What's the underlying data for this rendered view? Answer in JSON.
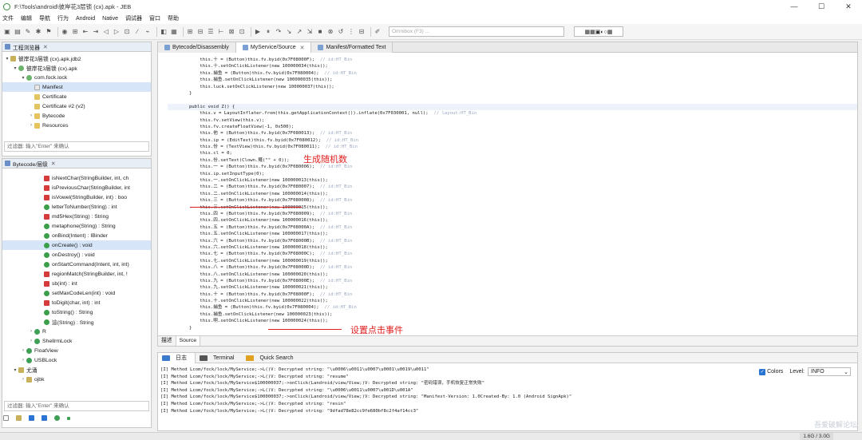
{
  "window": {
    "title": "F:\\Tools\\android\\彼岸花3层锁 (cx).apk - JEB",
    "controls": [
      "—",
      "☐",
      "✕"
    ]
  },
  "menu": [
    "文件",
    "编辑",
    "导航",
    "行为",
    "Android",
    "Native",
    "调试器",
    "窗口",
    "帮助"
  ],
  "toolbar": {
    "omnibox_placeholder": "Omnibox (F3) ...",
    "right_group": "▦▦▣◐○▦"
  },
  "project_panel": {
    "tab_label": "工程浏览器",
    "tree": [
      {
        "label": "彼岸花3层锁 (cx).apk.jdb2",
        "depth": 0,
        "icon": "package-icon",
        "arrow": "▾"
      },
      {
        "label": "彼岸花3层锁 (cx).apk",
        "depth": 1,
        "icon": "apk-icon",
        "arrow": "▾"
      },
      {
        "label": "com.fock.lock",
        "depth": 2,
        "icon": "apk-icon",
        "arrow": "▾"
      },
      {
        "label": "Manifest",
        "depth": 3,
        "icon": "file-icon",
        "arrow": "",
        "selected": true
      },
      {
        "label": "Certificate",
        "depth": 3,
        "icon": "cert-icon",
        "arrow": ""
      },
      {
        "label": "Certificate #2 (v2)",
        "depth": 3,
        "icon": "cert-icon",
        "arrow": ""
      },
      {
        "label": "Bytecode",
        "depth": 3,
        "icon": "folder-icon",
        "arrow": "›"
      },
      {
        "label": "Resources",
        "depth": 3,
        "icon": "folder-icon",
        "arrow": "›"
      }
    ],
    "filter_placeholder": "过滤器: 输入\"Enter\" 来确认"
  },
  "hierarchy_panel": {
    "tab_label": "Bytecode/层级",
    "tree": [
      {
        "label": "isNextChar(StringBuilder, int, ch",
        "icon": "red",
        "depth": 4
      },
      {
        "label": "isPreviousChar(StringBuilder, int",
        "icon": "red",
        "depth": 4
      },
      {
        "label": "isVowel(StringBuilder, int) : boo",
        "icon": "red",
        "depth": 4
      },
      {
        "label": "letterToNumber(String) : int",
        "icon": "green",
        "depth": 4
      },
      {
        "label": "md5Hex(String) : String",
        "icon": "red",
        "depth": 4
      },
      {
        "label": "metaphone(String) : String",
        "icon": "green",
        "depth": 4
      },
      {
        "label": "onBind(Intent) : IBinder",
        "icon": "green",
        "depth": 4
      },
      {
        "label": "onCreate() : void",
        "icon": "green",
        "depth": 4,
        "selected": true
      },
      {
        "label": "onDestroy() : void",
        "icon": "green",
        "depth": 4
      },
      {
        "label": "onStartCommand(Intent, int, int)",
        "icon": "green",
        "depth": 4
      },
      {
        "label": "regionMatch(StringBuilder, int, !",
        "icon": "red",
        "depth": 4
      },
      {
        "label": "sb(int) : int",
        "icon": "red",
        "depth": 4
      },
      {
        "label": "setMaxCodeLen(int) : void",
        "icon": "green",
        "depth": 4
      },
      {
        "label": "toDigit(char, int) : int",
        "icon": "red",
        "depth": 4
      },
      {
        "label": "toString() : String",
        "icon": "green",
        "depth": 4
      },
      {
        "label": "這(String) : String",
        "icon": "green",
        "depth": 4
      },
      {
        "label": "R",
        "icon": "class",
        "depth": 2,
        "arrow": "›"
      },
      {
        "label": "ShellrmLock",
        "icon": "class",
        "depth": 2,
        "arrow": "›"
      },
      {
        "label": "FloatView",
        "icon": "class",
        "depth": 1,
        "arrow": "›"
      },
      {
        "label": "USBLock",
        "icon": "class",
        "depth": 1,
        "arrow": "›"
      },
      {
        "label": "尤涌",
        "icon": "pkg",
        "depth": 0,
        "arrow": "▾"
      },
      {
        "label": "ojbk",
        "icon": "pkg",
        "depth": 1,
        "arrow": "›"
      }
    ],
    "filter_placeholder": "过滤器: 输入\"Enter\" 来确认"
  },
  "editor": {
    "tabs": [
      {
        "label": "Bytecode/Disassembly",
        "active": false
      },
      {
        "label": "MyService/Source",
        "active": true,
        "close": "✕"
      },
      {
        "label": "Manifest/Formatted Text",
        "active": false
      }
    ],
    "code_lines": [
      {
        "t": "            this.十 = (Button)this.fv.byid(0x7F08000F);  // id:HT_Bin"
      },
      {
        "t": "            this.十.setOnClickListener(new 100000034(this));"
      },
      {
        "t": "            this.捕鱼 = (Button)this.fv.byid(0x7F080004);  // id:HT_Bin"
      },
      {
        "t": "            this.捕鱼.setOnClickListener(new 100000035(this));"
      },
      {
        "t": "            this.luck.setOnClickListener(new 100000037(this));"
      },
      {
        "t": "        }"
      },
      {
        "t": ""
      },
      {
        "t": "        public void Z() {",
        "hl": true
      },
      {
        "t": "            this.v = LayoutInflater.from(this.getApplicationContext()).inflate(0x7F030001, null);  // layout:HT_Bin"
      },
      {
        "t": "            this.fv.setView(this.v);"
      },
      {
        "t": "            this.fv.createFloatView(-1, 0x500);"
      },
      {
        "t": "            this.他 = (Button)this.fv.byid(0x7F080013);  // id:HT_Bin"
      },
      {
        "t": "            this.ip = (EditText)this.fv.byid(0x7F080012);  // id:HT_Bin"
      },
      {
        "t": "            this.份 = (TextView)this.fv.byid(0x7F080011);  // id:HT_Bin"
      },
      {
        "t": "            this.cl = 0;"
      },
      {
        "t": "            this.份.setText(Clown.賤(\"\" + 0));"
      },
      {
        "t": "            this.一 = (Button)this.fv.byid(0x7F080006);  // id:HT_Bin"
      },
      {
        "t": "            this.ip.setInputType(0);"
      },
      {
        "t": "            this.一.setOnClickListener(new 100000013(this));"
      },
      {
        "t": "            this.二 = (Button)this.fv.byid(0x7F080007);  // id:HT_Bin"
      },
      {
        "t": "            this.二.setOnClickListener(new 100000014(this));"
      },
      {
        "t": "            this.三 = (Button)this.fv.byid(0x7F080008);  // id:HT_Bin"
      },
      {
        "t": "            this.三.setOnClickListener(new 100000015(this));"
      },
      {
        "t": "            this.四 = (Button)this.fv.byid(0x7F080009);  // id:HT_Bin"
      },
      {
        "t": "            this.四.setOnClickListener(new 100000016(this));"
      },
      {
        "t": "            this.五 = (Button)this.fv.byid(0x7F08000A);  // id:HT_Bin"
      },
      {
        "t": "            this.五.setOnClickListener(new 100000017(this));"
      },
      {
        "t": "            this.六 = (Button)this.fv.byid(0x7F08000B);  // id:HT_Bin"
      },
      {
        "t": "            this.六.setOnClickListener(new 100000018(this));"
      },
      {
        "t": "            this.七 = (Button)this.fv.byid(0x7F08000C);  // id:HT_Bin"
      },
      {
        "t": "            this.七.setOnClickListener(new 100000019(this));"
      },
      {
        "t": "            this.八 = (Button)this.fv.byid(0x7F08000D);  // id:HT_Bin"
      },
      {
        "t": "            this.八.setOnClickListener(new 100000020(this));"
      },
      {
        "t": "            this.九 = (Button)this.fv.byid(0x7F08000E);  // id:HT_Bin"
      },
      {
        "t": "            this.九.setOnClickListener(new 100000021(this));"
      },
      {
        "t": "            this.十 = (Button)this.fv.byid(0x7F08000F);  // id:HT_Bin"
      },
      {
        "t": "            this.十.setOnClickListener(new 100000022(this));"
      },
      {
        "t": "            this.捕鱼 = (Button)this.fv.byid(0x7F080004);  // id:HT_Bin"
      },
      {
        "t": "            this.捕鱼.setOnClickListener(new 100000023(this));"
      },
      {
        "t": "            this.啊.setOnClickListener(new 100000024(this));"
      },
      {
        "t": "        }"
      }
    ],
    "annotation_random": "生成随机数",
    "annotation_click": "设置点击事件",
    "source_tabs": [
      "描述",
      "Source"
    ]
  },
  "log_panel": {
    "tabs": [
      "日志",
      "Terminal",
      "Quick Search"
    ],
    "lines": [
      "[I] Method Lcom/fock/lock/MyService;->L()V: Decrypted string: \"\\u0006\\u0011\\u0007\\u0001\\u0019\\u0011\"",
      "[I] Method Lcom/fock/lock/MyService;->L()V: Decrypted string: \"resume\"",
      "[I] Method Lcom/fock/lock/MyService$100000037;->onClick(Landroid/view/View;)V: Decrypted string: \"密码错误，手机恢复正常失败\"",
      "[I] Method Lcom/fock/lock/MyService;->L()V: Decrypted string: \"\\u0006\\u0011\\u0007\\u001D\\u001A\"",
      "[I] Method Lcom/fock/lock/MyService$100000037;->onClick(Landroid/view/View;)V: Decrypted string: \"Manifest-Version: 1.0Created-By: 1.0 (Android SignApk)\"",
      "[I] Method Lcom/fock/lock/MyService;->L()V: Decrypted string: \"resin\"",
      "[I] Method Lcom/fock/lock/MyService;->L()V: Decrypted string: \"9dfad78e82cc9fe680bf8c2f4af14cc3\""
    ],
    "colors_label": "Colors",
    "level_label": "Level:",
    "level_value": "INFO"
  },
  "status": {
    "heap": "1.6G / 3.0G"
  },
  "watermark": "吾爱破解论坛",
  "colors": {
    "annotation": "#e02020",
    "accent": "#2a74d4"
  }
}
